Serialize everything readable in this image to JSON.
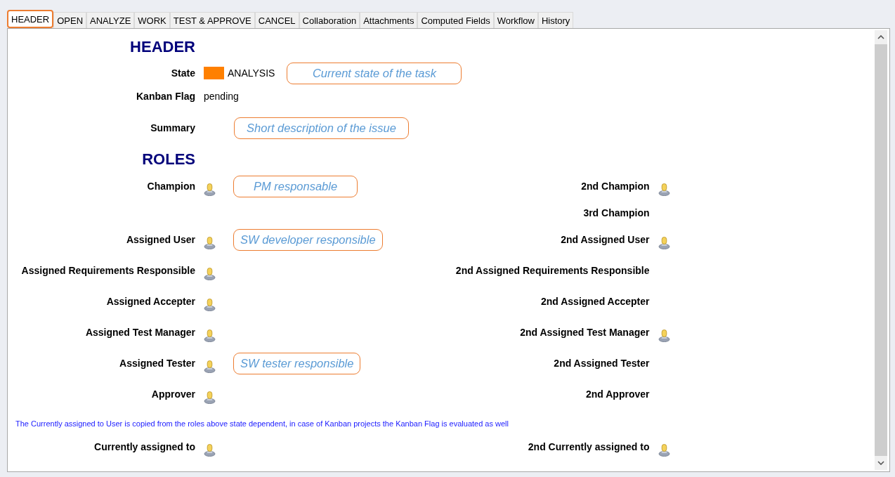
{
  "tabs": [
    {
      "label": "HEADER",
      "selected": true
    },
    {
      "label": "OPEN",
      "selected": false
    },
    {
      "label": "ANALYZE",
      "selected": false
    },
    {
      "label": "WORK",
      "selected": false
    },
    {
      "label": "TEST & APPROVE",
      "selected": false
    },
    {
      "label": "CANCEL",
      "selected": false
    },
    {
      "label": "Collaboration",
      "selected": false
    },
    {
      "label": "Attachments",
      "selected": false
    },
    {
      "label": "Computed Fields",
      "selected": false
    },
    {
      "label": "Workflow",
      "selected": false
    },
    {
      "label": "History",
      "selected": false
    }
  ],
  "header": {
    "title": "HEADER",
    "fields": [
      {
        "kind": "state",
        "label": "State",
        "value": "ANALYSIS",
        "color": "#ff8000",
        "callout": "Current state of the task"
      },
      {
        "kind": "text",
        "label": "Kanban Flag",
        "value": "pending"
      },
      {
        "kind": "summary",
        "label": "Summary",
        "callout": "Short description of the issue"
      }
    ]
  },
  "roles": {
    "title": "ROLES",
    "rows": [
      {
        "left": {
          "label": "Champion",
          "user_icon": true,
          "callout": "PM responsable"
        },
        "right": {
          "label": "2nd Champion",
          "user_icon": true
        }
      },
      {
        "right": {
          "label": "3rd Champion",
          "user_icon": false
        }
      },
      {
        "left": {
          "label": "Assigned User",
          "user_icon": true,
          "callout": "SW developer responsible"
        },
        "right": {
          "label": "2nd Assigned User",
          "user_icon": true
        }
      },
      {
        "left": {
          "label": "Assigned Requirements Responsible",
          "user_icon": true
        },
        "right": {
          "label": "2nd Assigned Requirements Responsible",
          "user_icon": false
        }
      },
      {
        "left": {
          "label": "Assigned Accepter",
          "user_icon": true
        },
        "right": {
          "label": "2nd Assigned Accepter",
          "user_icon": false
        }
      },
      {
        "left": {
          "label": "Assigned Test Manager",
          "user_icon": true
        },
        "right": {
          "label": "2nd Assigned Test Manager",
          "user_icon": true
        }
      },
      {
        "left": {
          "label": "Assigned Tester",
          "user_icon": true,
          "callout": "SW tester responsible"
        },
        "right": {
          "label": "2nd Assigned Tester",
          "user_icon": false
        }
      },
      {
        "left": {
          "label": "Approver",
          "user_icon": true
        },
        "right": {
          "label": "2nd Approver",
          "user_icon": false
        }
      }
    ],
    "note": "The Currently assigned to User is copied from the roles above state dependent, in case of Kanban projects the Kanban Flag is evaluated as well",
    "current": {
      "left": {
        "label": "Currently assigned to",
        "user_icon": true
      },
      "right": {
        "label": "2nd Currently assigned to",
        "user_icon": true
      }
    }
  }
}
